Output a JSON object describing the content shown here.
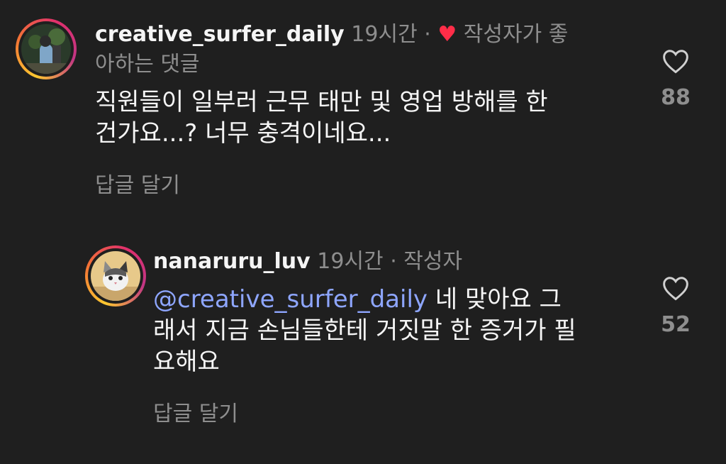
{
  "comments": [
    {
      "username": "creative_surfer_daily",
      "time": "19시간",
      "separator": "·",
      "liked_label": "작성자가 좋",
      "liked_label_cont": "아하는 댓글",
      "text_line1": "직원들이 일부러 근무 태만 및 영업 방해를 한",
      "text_line2": "건가요...? 너무 충격이네요...",
      "reply_label": "답글 달기",
      "like_count": "88",
      "avatar_icon": "photo-avatar"
    },
    {
      "username": "nanaruru_luv",
      "time": "19시간",
      "separator": "·",
      "author_label": "작성자",
      "mention": "@creative_surfer_daily",
      "text_line1": " 네 맞아요 그",
      "text_line2": "래서 지금 손님들한테 거짓말 한 증거가 필",
      "text_line3": "요해요",
      "reply_label": "답글 달기",
      "like_count": "52",
      "avatar_icon": "cat-avatar"
    }
  ],
  "colors": {
    "background": "#1f1f1f",
    "meta": "#8e8e8e",
    "mention": "#8ea6ff",
    "liked_heart": "#ff2d48"
  }
}
